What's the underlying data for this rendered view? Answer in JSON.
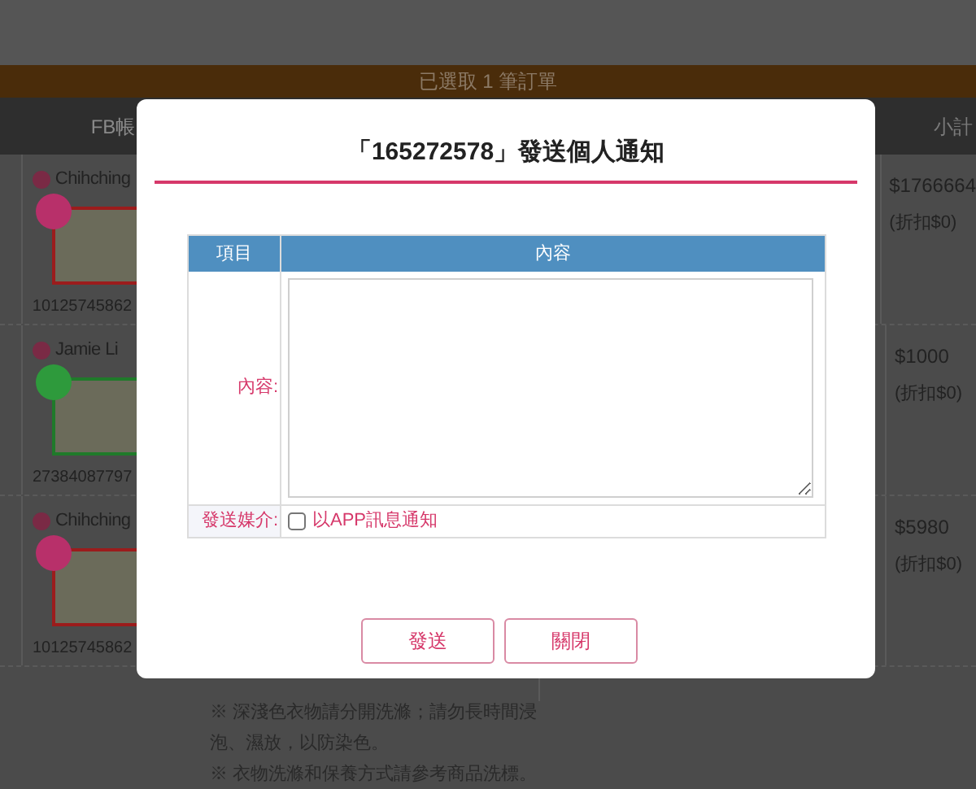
{
  "background": {
    "banner": "已選取 1 筆訂單",
    "columns": [
      {
        "label": "FB帳"
      },
      {
        "label": "小計"
      }
    ],
    "rows": [
      {
        "name": "Chihching",
        "kind": "vip",
        "account_id": "10125745862",
        "subtotal": "$1766664",
        "discount": "(折扣$0)"
      },
      {
        "name": "Jamie Li",
        "kind": "new",
        "account_id": "27384087797",
        "subtotal": "$1000",
        "discount": "(折扣$0)"
      },
      {
        "name": "Chihching",
        "kind": "vip",
        "account_id": "10125745862",
        "subtotal": "$5980",
        "discount": "(折扣$0)"
      }
    ],
    "notes": [
      "※ 深淺色衣物請分開洗滌；請勿長時間浸",
      "泡、濕放，以防染色。",
      "※ 衣物洗滌和保養方式請參考商品洗標。"
    ]
  },
  "dialog": {
    "title": "「165272578」發送個人通知",
    "table": {
      "columns": [
        "項目",
        "內容"
      ],
      "content_label": "內容:",
      "media_label": "發送媒介:",
      "app_option": {
        "label": "以APP訊息通知",
        "checked": false
      }
    },
    "buttons": [
      "發送",
      "關閉"
    ]
  }
}
